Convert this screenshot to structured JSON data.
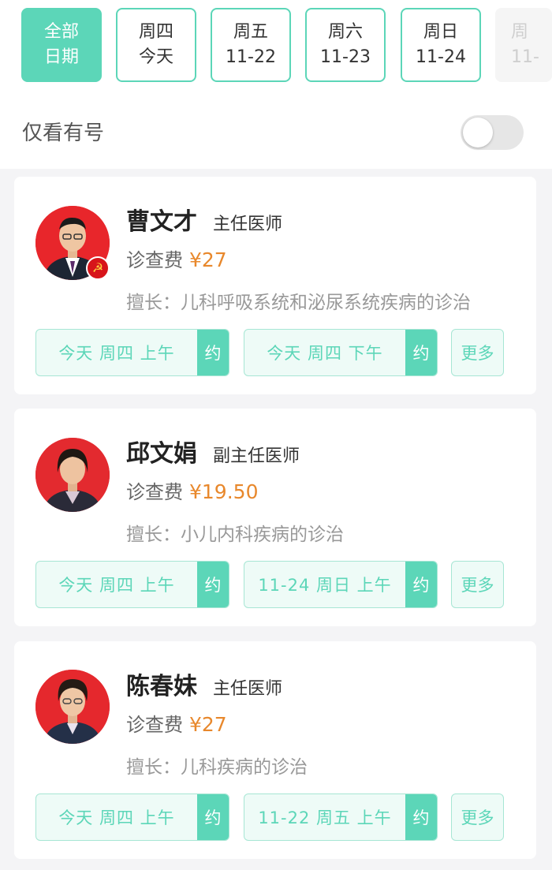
{
  "date_filter": {
    "chips": [
      {
        "line1": "全部",
        "line2": "日期"
      },
      {
        "line1": "周四",
        "line2": "今天"
      },
      {
        "line1": "周五",
        "line2": "11-22"
      },
      {
        "line1": "周六",
        "line2": "11-23"
      },
      {
        "line1": "周日",
        "line2": "11-24"
      },
      {
        "line1": "周",
        "line2": "11-"
      }
    ],
    "active_index": 0
  },
  "availability_filter": {
    "label": "仅看有号",
    "enabled": false
  },
  "accent_color": "#5cd6b8",
  "fee_color": "#e8882c",
  "doctors": [
    {
      "name": "曹文才",
      "title": "主任医师",
      "fee_label": "诊查费",
      "fee": "¥27",
      "specialty": "擅长：儿科呼吸系统和泌尿系统疾病的诊治",
      "badge_icon": "party-emblem-icon",
      "slots": [
        {
          "text": "今天 周四 上午",
          "action": "约"
        },
        {
          "text": "今天 周四 下午",
          "action": "约"
        }
      ],
      "more_label": "更多"
    },
    {
      "name": "邱文娟",
      "title": "副主任医师",
      "fee_label": "诊查费",
      "fee": "¥19.50",
      "specialty": "擅长：小儿内科疾病的诊治",
      "slots": [
        {
          "text": "今天 周四 上午",
          "action": "约"
        },
        {
          "text": "11-24 周日 上午",
          "action": "约"
        }
      ],
      "more_label": "更多"
    },
    {
      "name": "陈春妹",
      "title": "主任医师",
      "fee_label": "诊查费",
      "fee": "¥27",
      "specialty": "擅长：儿科疾病的诊治",
      "slots": [
        {
          "text": "今天 周四 上午",
          "action": "约"
        },
        {
          "text": "11-22 周五 上午",
          "action": "约"
        }
      ],
      "more_label": "更多"
    }
  ]
}
